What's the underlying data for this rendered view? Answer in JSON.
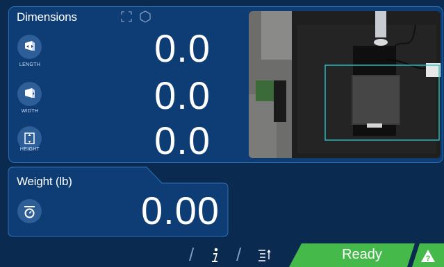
{
  "dimensions": {
    "title": "Dimensions",
    "length": {
      "label": "LENGTH",
      "value": "0.0"
    },
    "width": {
      "label": "WIDTH",
      "value": "0.0"
    },
    "height": {
      "label": "HEIGHT",
      "value": "0.0"
    },
    "icons": [
      "expand-icon",
      "box-outline-icon"
    ]
  },
  "weight": {
    "title": "Weight (lb)",
    "value": "0.00",
    "icon": "scale-icon"
  },
  "footer": {
    "info_icon": "i",
    "sort_icon": "sort-icon",
    "status": "Ready",
    "status_icon": "warning-icon"
  },
  "colors": {
    "background": "#0b2a4f",
    "panel": "#0e3d75",
    "panel_border": "#2c6fb6",
    "ready": "#45b94a",
    "detect_box": "#20c7c9"
  }
}
